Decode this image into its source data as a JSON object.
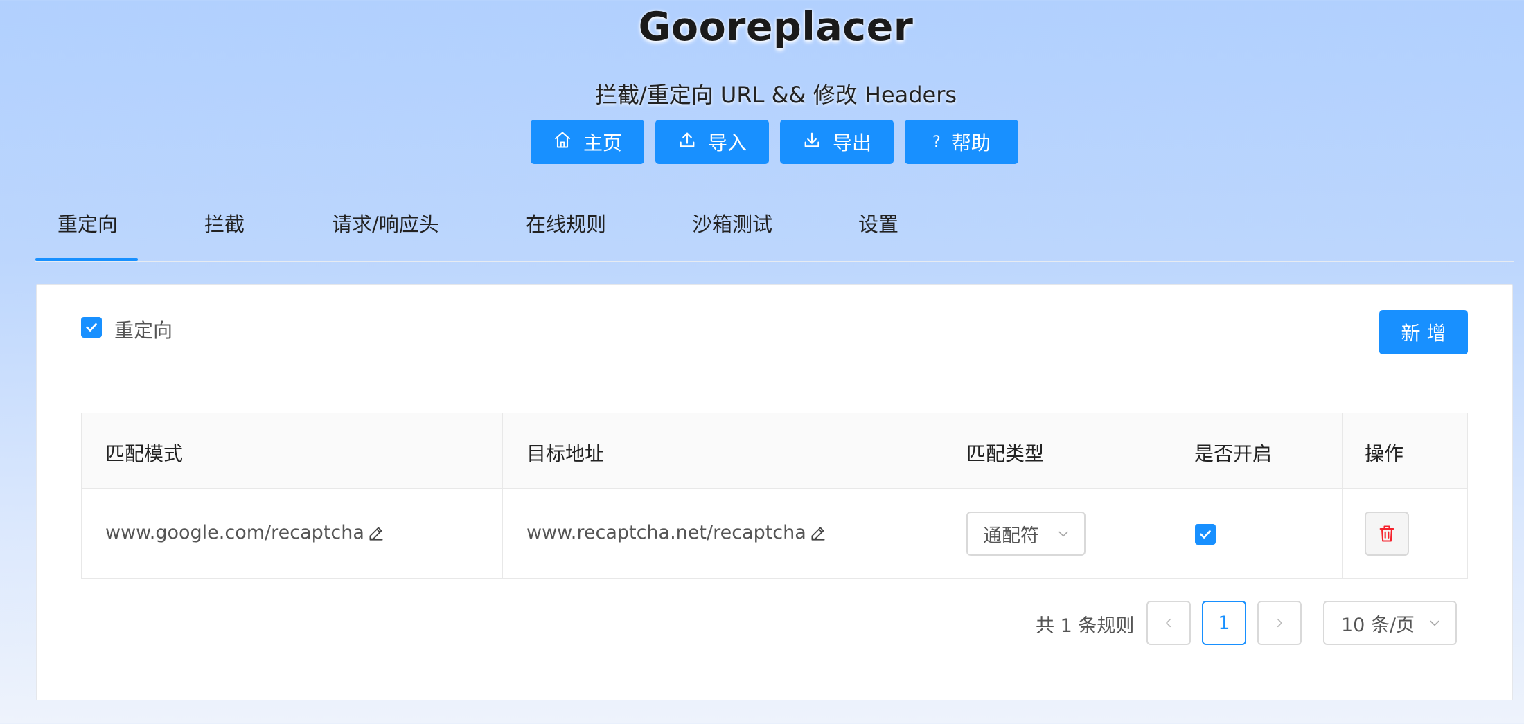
{
  "header": {
    "title": "Gooreplacer",
    "subtitle": "拦截/重定向 URL && 修改 Headers"
  },
  "toolbar": {
    "home_label": "主页",
    "import_label": "导入",
    "export_label": "导出",
    "help_label": "帮助"
  },
  "tabs": [
    {
      "label": "重定向",
      "active": true
    },
    {
      "label": "拦截"
    },
    {
      "label": "请求/响应头"
    },
    {
      "label": "在线规则"
    },
    {
      "label": "沙箱测试"
    },
    {
      "label": "设置"
    }
  ],
  "panel": {
    "enable_label": "重定向",
    "enabled": true,
    "add_label": "新 增"
  },
  "table": {
    "columns": [
      "匹配模式",
      "目标地址",
      "匹配类型",
      "是否开启",
      "操作"
    ],
    "rows": [
      {
        "pattern": "www.google.com/recaptcha",
        "target": "www.recaptcha.net/recaptcha",
        "match_type": "通配符",
        "enabled": true
      }
    ]
  },
  "pagination": {
    "total_text": "共 1 条规则",
    "current_page": "1",
    "page_size": "10 条/页"
  },
  "colors": {
    "accent": "#1890ff",
    "danger": "#f5222d"
  }
}
